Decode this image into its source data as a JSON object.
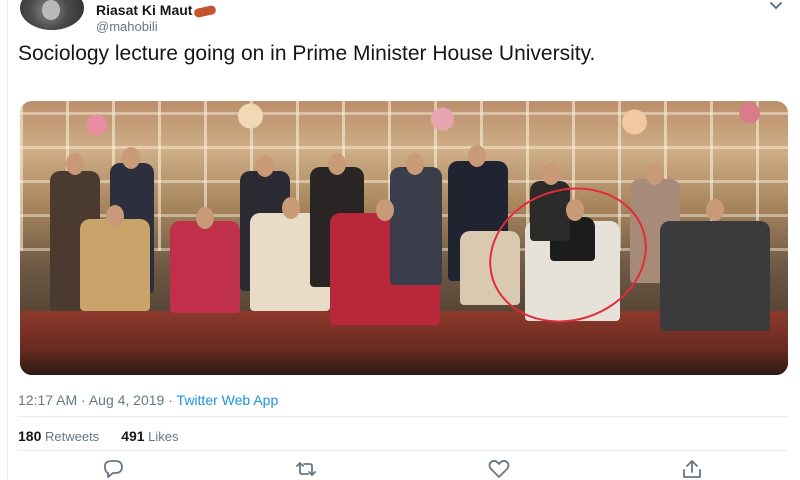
{
  "tweet": {
    "display_name": "Riasat Ki Maut",
    "handle": "@mahobili",
    "text": "Sociology lecture going on in Prime Minister House University.",
    "timestamp": "12:17 AM · Aug 4, 2019",
    "separator": " · ",
    "source": "Twitter Web App",
    "retweets_count": "180",
    "retweets_label": "Retweets",
    "likes_count": "491",
    "likes_label": "Likes"
  },
  "colors": {
    "accent": "#1b95e0",
    "secondary_text": "#657786",
    "annotation_circle": "#e22c3b"
  },
  "icons": [
    "chevron-down-icon",
    "reply-icon",
    "retweet-icon",
    "like-icon",
    "share-icon"
  ]
}
